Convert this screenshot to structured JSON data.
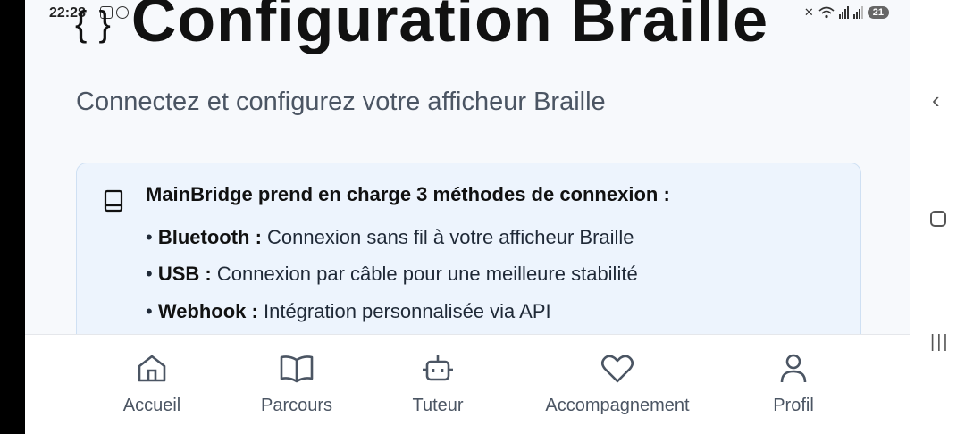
{
  "status_bar": {
    "time": "22:28",
    "battery": "21"
  },
  "header": {
    "title": "Configuration Braille",
    "subtitle": "Connectez et configurez votre afficheur Braille"
  },
  "info_card": {
    "lead": "MainBridge prend en charge 3 méthodes de connexion :",
    "items": [
      {
        "bullet": "•",
        "name": "Bluetooth :",
        "desc": "Connexion sans fil à votre afficheur Braille"
      },
      {
        "bullet": "•",
        "name": "USB :",
        "desc": "Connexion par câble pour une meilleure stabilité"
      },
      {
        "bullet": "•",
        "name": "Webhook :",
        "desc": "Intégration personnalisée via API"
      }
    ]
  },
  "bottom_nav": {
    "items": [
      {
        "label": "Accueil",
        "icon": "home-icon"
      },
      {
        "label": "Parcours",
        "icon": "book-icon"
      },
      {
        "label": "Tuteur",
        "icon": "robot-icon"
      },
      {
        "label": "Accompagnement",
        "icon": "heart-icon"
      },
      {
        "label": "Profil",
        "icon": "user-icon"
      }
    ]
  },
  "colors": {
    "background": "#f7f9fc",
    "card_bg": "#edf4fd",
    "card_border": "#cfe0f3",
    "text_muted": "#4b5563"
  }
}
